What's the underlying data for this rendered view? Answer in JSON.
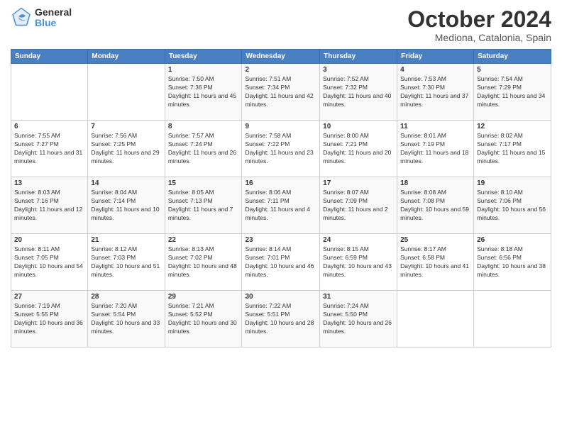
{
  "header": {
    "logo": {
      "line1": "General",
      "line2": "Blue"
    },
    "title": "October 2024",
    "location": "Mediona, Catalonia, Spain"
  },
  "calendar": {
    "days_of_week": [
      "Sunday",
      "Monday",
      "Tuesday",
      "Wednesday",
      "Thursday",
      "Friday",
      "Saturday"
    ],
    "weeks": [
      [
        {
          "day": "",
          "info": ""
        },
        {
          "day": "",
          "info": ""
        },
        {
          "day": "1",
          "info": "Sunrise: 7:50 AM\nSunset: 7:36 PM\nDaylight: 11 hours and 45 minutes."
        },
        {
          "day": "2",
          "info": "Sunrise: 7:51 AM\nSunset: 7:34 PM\nDaylight: 11 hours and 42 minutes."
        },
        {
          "day": "3",
          "info": "Sunrise: 7:52 AM\nSunset: 7:32 PM\nDaylight: 11 hours and 40 minutes."
        },
        {
          "day": "4",
          "info": "Sunrise: 7:53 AM\nSunset: 7:30 PM\nDaylight: 11 hours and 37 minutes."
        },
        {
          "day": "5",
          "info": "Sunrise: 7:54 AM\nSunset: 7:29 PM\nDaylight: 11 hours and 34 minutes."
        }
      ],
      [
        {
          "day": "6",
          "info": "Sunrise: 7:55 AM\nSunset: 7:27 PM\nDaylight: 11 hours and 31 minutes."
        },
        {
          "day": "7",
          "info": "Sunrise: 7:56 AM\nSunset: 7:25 PM\nDaylight: 11 hours and 29 minutes."
        },
        {
          "day": "8",
          "info": "Sunrise: 7:57 AM\nSunset: 7:24 PM\nDaylight: 11 hours and 26 minutes."
        },
        {
          "day": "9",
          "info": "Sunrise: 7:58 AM\nSunset: 7:22 PM\nDaylight: 11 hours and 23 minutes."
        },
        {
          "day": "10",
          "info": "Sunrise: 8:00 AM\nSunset: 7:21 PM\nDaylight: 11 hours and 20 minutes."
        },
        {
          "day": "11",
          "info": "Sunrise: 8:01 AM\nSunset: 7:19 PM\nDaylight: 11 hours and 18 minutes."
        },
        {
          "day": "12",
          "info": "Sunrise: 8:02 AM\nSunset: 7:17 PM\nDaylight: 11 hours and 15 minutes."
        }
      ],
      [
        {
          "day": "13",
          "info": "Sunrise: 8:03 AM\nSunset: 7:16 PM\nDaylight: 11 hours and 12 minutes."
        },
        {
          "day": "14",
          "info": "Sunrise: 8:04 AM\nSunset: 7:14 PM\nDaylight: 11 hours and 10 minutes."
        },
        {
          "day": "15",
          "info": "Sunrise: 8:05 AM\nSunset: 7:13 PM\nDaylight: 11 hours and 7 minutes."
        },
        {
          "day": "16",
          "info": "Sunrise: 8:06 AM\nSunset: 7:11 PM\nDaylight: 11 hours and 4 minutes."
        },
        {
          "day": "17",
          "info": "Sunrise: 8:07 AM\nSunset: 7:09 PM\nDaylight: 11 hours and 2 minutes."
        },
        {
          "day": "18",
          "info": "Sunrise: 8:08 AM\nSunset: 7:08 PM\nDaylight: 10 hours and 59 minutes."
        },
        {
          "day": "19",
          "info": "Sunrise: 8:10 AM\nSunset: 7:06 PM\nDaylight: 10 hours and 56 minutes."
        }
      ],
      [
        {
          "day": "20",
          "info": "Sunrise: 8:11 AM\nSunset: 7:05 PM\nDaylight: 10 hours and 54 minutes."
        },
        {
          "day": "21",
          "info": "Sunrise: 8:12 AM\nSunset: 7:03 PM\nDaylight: 10 hours and 51 minutes."
        },
        {
          "day": "22",
          "info": "Sunrise: 8:13 AM\nSunset: 7:02 PM\nDaylight: 10 hours and 48 minutes."
        },
        {
          "day": "23",
          "info": "Sunrise: 8:14 AM\nSunset: 7:01 PM\nDaylight: 10 hours and 46 minutes."
        },
        {
          "day": "24",
          "info": "Sunrise: 8:15 AM\nSunset: 6:59 PM\nDaylight: 10 hours and 43 minutes."
        },
        {
          "day": "25",
          "info": "Sunrise: 8:17 AM\nSunset: 6:58 PM\nDaylight: 10 hours and 41 minutes."
        },
        {
          "day": "26",
          "info": "Sunrise: 8:18 AM\nSunset: 6:56 PM\nDaylight: 10 hours and 38 minutes."
        }
      ],
      [
        {
          "day": "27",
          "info": "Sunrise: 7:19 AM\nSunset: 5:55 PM\nDaylight: 10 hours and 36 minutes."
        },
        {
          "day": "28",
          "info": "Sunrise: 7:20 AM\nSunset: 5:54 PM\nDaylight: 10 hours and 33 minutes."
        },
        {
          "day": "29",
          "info": "Sunrise: 7:21 AM\nSunset: 5:52 PM\nDaylight: 10 hours and 30 minutes."
        },
        {
          "day": "30",
          "info": "Sunrise: 7:22 AM\nSunset: 5:51 PM\nDaylight: 10 hours and 28 minutes."
        },
        {
          "day": "31",
          "info": "Sunrise: 7:24 AM\nSunset: 5:50 PM\nDaylight: 10 hours and 26 minutes."
        },
        {
          "day": "",
          "info": ""
        },
        {
          "day": "",
          "info": ""
        }
      ]
    ]
  }
}
